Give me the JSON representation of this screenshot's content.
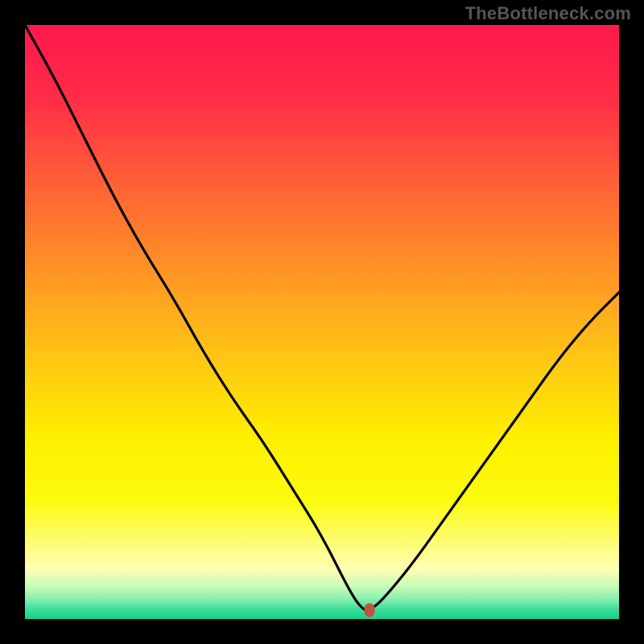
{
  "attribution": "TheBottleneck.com",
  "colors": {
    "background": "#000000",
    "curve": "#000000",
    "marker": "#c1543c",
    "gradient_stops": [
      {
        "pos": 0.0,
        "color": "#ff184d"
      },
      {
        "pos": 0.12,
        "color": "#ff2c47"
      },
      {
        "pos": 0.25,
        "color": "#ff5a39"
      },
      {
        "pos": 0.4,
        "color": "#ff8f27"
      },
      {
        "pos": 0.55,
        "color": "#ffc315"
      },
      {
        "pos": 0.7,
        "color": "#fff000"
      },
      {
        "pos": 0.8,
        "color": "#fbfb0e"
      },
      {
        "pos": 0.875,
        "color": "#fdfd7a"
      },
      {
        "pos": 0.915,
        "color": "#feffb2"
      },
      {
        "pos": 0.945,
        "color": "#c9fbb8"
      },
      {
        "pos": 0.965,
        "color": "#8cf0b0"
      },
      {
        "pos": 0.985,
        "color": "#38dd99"
      },
      {
        "pos": 1.0,
        "color": "#12d28b"
      }
    ]
  },
  "chart_data": {
    "type": "line",
    "title": "",
    "xlabel": "",
    "ylabel": "",
    "xlim": [
      0,
      100
    ],
    "ylim": [
      0,
      100
    ],
    "grid": false,
    "legend": false,
    "series": [
      {
        "name": "bottleneck-curve",
        "x": [
          0,
          5,
          10,
          15,
          20,
          25,
          30,
          35,
          40,
          45,
          50,
          55,
          57,
          58,
          60,
          65,
          70,
          75,
          80,
          85,
          90,
          95,
          100
        ],
        "y": [
          100,
          91,
          81,
          71,
          62,
          54,
          45,
          37,
          30,
          22,
          14,
          4.0,
          1.5,
          1.5,
          3.0,
          9.0,
          16,
          23,
          30,
          37,
          44,
          50,
          55
        ]
      }
    ],
    "marker": {
      "x": 58,
      "y": 1.5
    },
    "notes": "Background is a vertical heat gradient (red→yellow→green). Curve is a V-shaped bottleneck line drawn in black, with a small rounded orange marker at the valley."
  }
}
